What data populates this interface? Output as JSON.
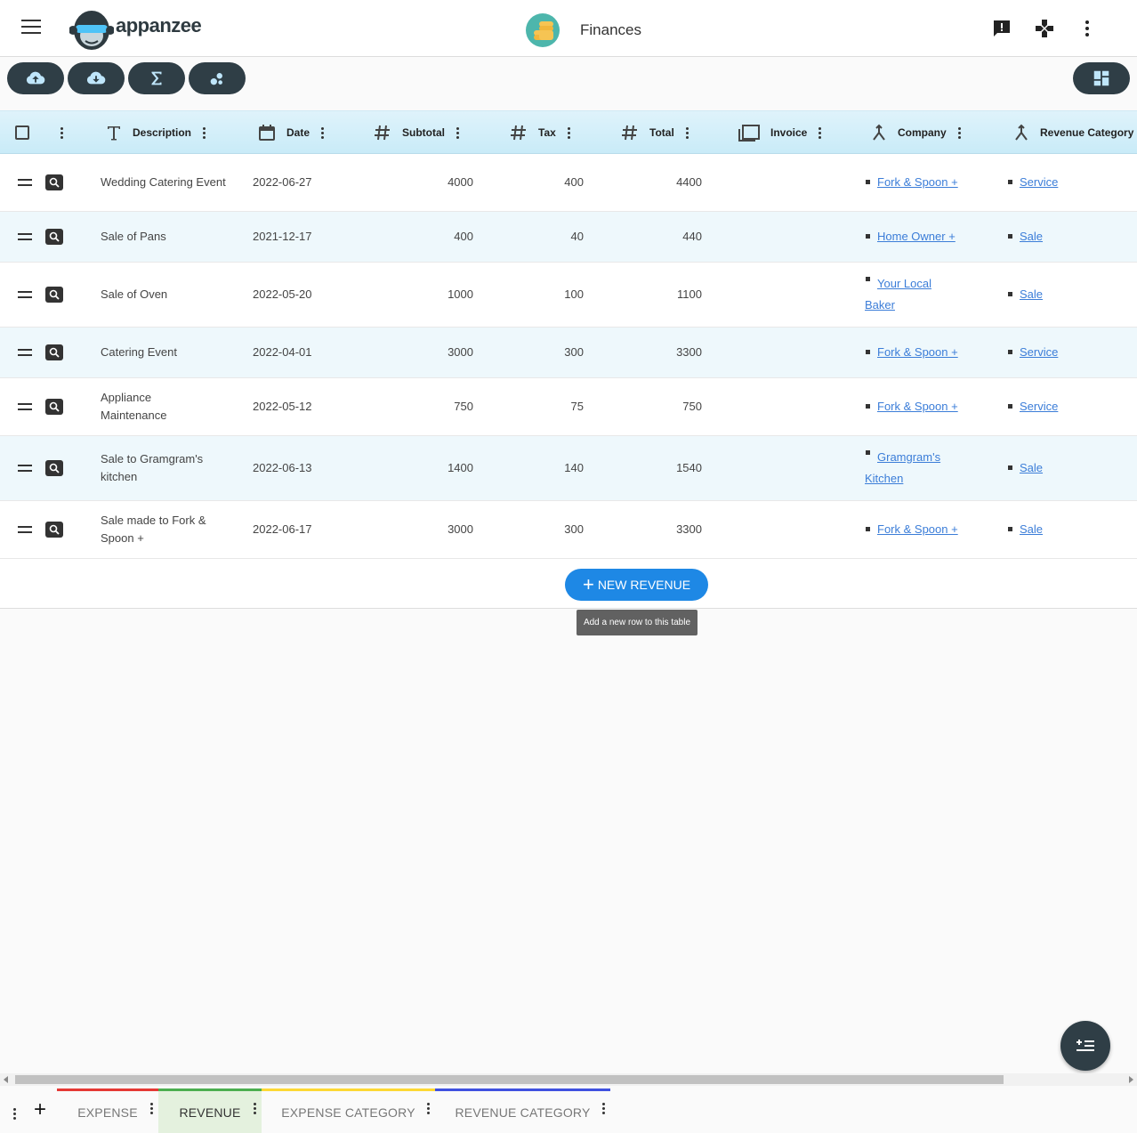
{
  "header": {
    "app_title": "Finances",
    "logo_text": "appanzee"
  },
  "table": {
    "columns": [
      {
        "label": "Description",
        "icon": "text-icon"
      },
      {
        "label": "Date",
        "icon": "calendar-icon"
      },
      {
        "label": "Subtotal",
        "icon": "hash-icon"
      },
      {
        "label": "Tax",
        "icon": "hash-icon"
      },
      {
        "label": "Total",
        "icon": "hash-icon"
      },
      {
        "label": "Invoice",
        "icon": "folder-icon"
      },
      {
        "label": "Company",
        "icon": "link-icon"
      },
      {
        "label": "Revenue Category",
        "icon": "link-icon"
      }
    ],
    "rows": [
      {
        "description": "Wedding Catering Event",
        "date": "2022-06-27",
        "subtotal": "4000",
        "tax": "400",
        "total": "4400",
        "company": "Fork & Spoon +",
        "category": "Service"
      },
      {
        "description": "Sale of Pans",
        "date": "2021-12-17",
        "subtotal": "400",
        "tax": "40",
        "total": "440",
        "company": "Home Owner +",
        "category": "Sale"
      },
      {
        "description": "Sale of Oven",
        "date": "2022-05-20",
        "subtotal": "1000",
        "tax": "100",
        "total": "1100",
        "company": "Your Local Baker",
        "category": "Sale"
      },
      {
        "description": "Catering Event",
        "date": "2022-04-01",
        "subtotal": "3000",
        "tax": "300",
        "total": "3300",
        "company": "Fork & Spoon +",
        "category": "Service"
      },
      {
        "description": "Appliance Maintenance",
        "date": "2022-05-12",
        "subtotal": "750",
        "tax": "75",
        "total": "750",
        "company": "Fork & Spoon +",
        "category": "Service"
      },
      {
        "description": "Sale to Gramgram's kitchen",
        "date": "2022-06-13",
        "subtotal": "1400",
        "tax": "140",
        "total": "1540",
        "company": "Gramgram's Kitchen",
        "category": "Sale"
      },
      {
        "description": "Sale made to Fork & Spoon +",
        "date": "2022-06-17",
        "subtotal": "3000",
        "tax": "300",
        "total": "3300",
        "company": "Fork & Spoon +",
        "category": "Sale"
      }
    ],
    "new_button_label": "NEW REVENUE",
    "tooltip": "Add a new row to this table"
  },
  "tabs": [
    {
      "label": "EXPENSE",
      "color": "#e53935"
    },
    {
      "label": "REVENUE",
      "color": "#4caf50"
    },
    {
      "label": "EXPENSE CATEGORY",
      "color": "#fdd835"
    },
    {
      "label": "REVENUE CATEGORY",
      "color": "#3f51e0"
    }
  ],
  "colors": {
    "dark_button": "#2f3e46",
    "primary": "#1e88e5",
    "link": "#3b7dd8"
  }
}
